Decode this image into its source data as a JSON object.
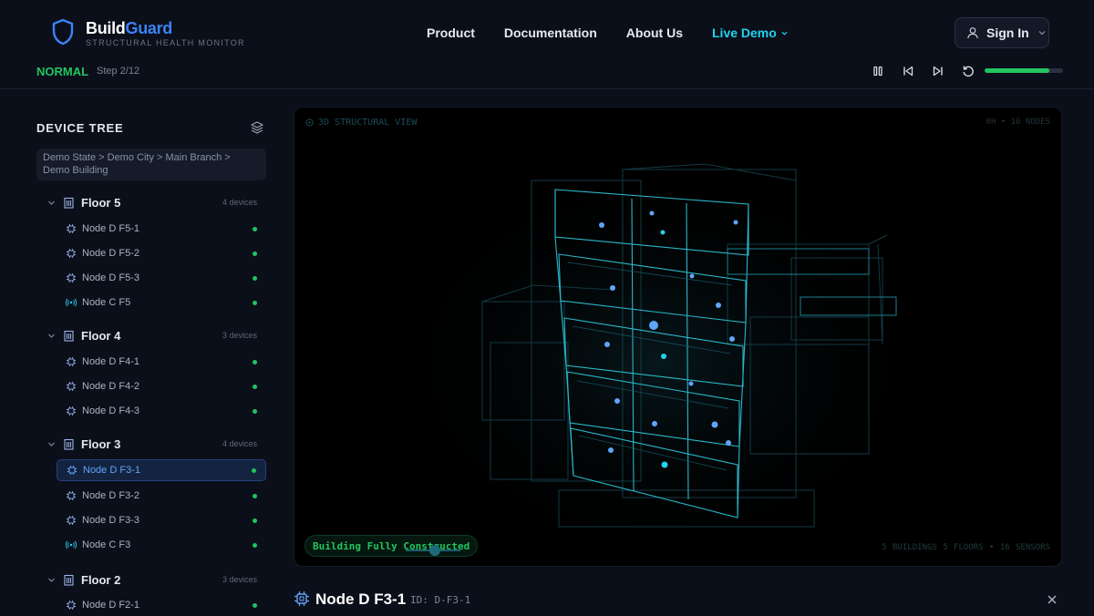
{
  "brand": {
    "name_part1": "Build",
    "name_part2": "Guard",
    "tagline": "STRUCTURAL HEALTH MONITOR",
    "accent": "#3b82f6"
  },
  "nav": {
    "items": [
      {
        "label": "Product"
      },
      {
        "label": "Documentation"
      },
      {
        "label": "About Us"
      }
    ],
    "active": {
      "label": "Live Demo",
      "color": "#22d3ee"
    },
    "signin_label": "Sign In"
  },
  "status": {
    "state": "NORMAL",
    "state_color": "#22c55e",
    "step": "Step 2/12",
    "progress_fraction": 0.82,
    "controls": [
      "pause-icon",
      "skip-back-icon",
      "skip-forward-icon",
      "restart-icon"
    ]
  },
  "sidebar": {
    "title": "DEVICE TREE",
    "breadcrumb": "Demo State > Demo City > Main Branch > Demo Building",
    "floors": [
      {
        "name": "Floor 5",
        "count": "4 devices",
        "nodes": [
          {
            "name": "Node D F5-1",
            "type": "chip"
          },
          {
            "name": "Node D F5-2",
            "type": "chip"
          },
          {
            "name": "Node D F5-3",
            "type": "chip"
          },
          {
            "name": "Node C F5",
            "type": "radio"
          }
        ]
      },
      {
        "name": "Floor 4",
        "count": "3 devices",
        "nodes": [
          {
            "name": "Node D F4-1",
            "type": "chip"
          },
          {
            "name": "Node D F4-2",
            "type": "chip"
          },
          {
            "name": "Node D F4-3",
            "type": "chip"
          }
        ]
      },
      {
        "name": "Floor 3",
        "count": "4 devices",
        "nodes": [
          {
            "name": "Node D F3-1",
            "type": "chip",
            "selected": true
          },
          {
            "name": "Node D F3-2",
            "type": "chip"
          },
          {
            "name": "Node D F3-3",
            "type": "chip"
          },
          {
            "name": "Node C F3",
            "type": "radio"
          }
        ]
      },
      {
        "name": "Floor 2",
        "count": "3 devices",
        "nodes": [
          {
            "name": "Node D F2-1",
            "type": "chip"
          }
        ]
      }
    ]
  },
  "viewport": {
    "label": "3D STRUCTURAL VIEW",
    "top_right": "0H • 16 NODES",
    "badge": "Building Fully Constructed",
    "stats": "5 BUILDINGS  5 FLOORS • 16 SENSORS",
    "wire_color": "#2ab7c9",
    "sensor_color": "#60a5fa"
  },
  "details": {
    "name": "Node D F3-1",
    "id_text": "ID: D-F3-1"
  }
}
